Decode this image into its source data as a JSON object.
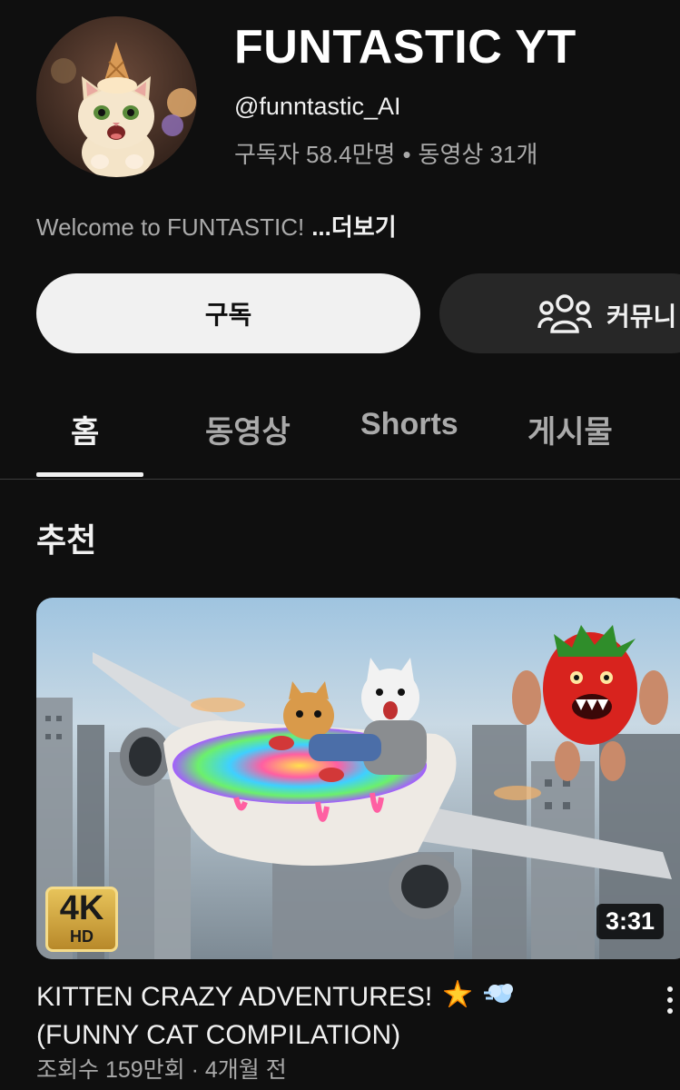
{
  "channel": {
    "title": "FUNTASTIC YT",
    "handle": "@funntastic_AI",
    "subscribers": "구독자 58.4만명",
    "separator": "•",
    "video_count": "동영상 31개",
    "description": "Welcome to FUNTASTIC!",
    "more_label": "...더보기",
    "avatar_icon": "cat-with-ice-cream-cone-icon"
  },
  "actions": {
    "subscribe_label": "구독",
    "community_label": "커뮤니",
    "community_icon": "people-group-icon"
  },
  "tabs": [
    {
      "label": "홈",
      "active": true
    },
    {
      "label": "동영상",
      "active": false
    },
    {
      "label": "Shorts",
      "active": false
    },
    {
      "label": "게시물",
      "active": false
    }
  ],
  "section": {
    "title": "추천"
  },
  "video": {
    "title_line1": "KITTEN CRAZY ADVENTURES!",
    "title_line2": "(FUNNY CAT COMPILATION)",
    "views": "조회수 159만회",
    "meta_separator": "·",
    "age": "4개월 전",
    "duration": "3:31",
    "badge_main": "4K",
    "badge_sub": "HD",
    "menu_icon": "more-vert-icon",
    "sticker_icons": [
      "sparkle-icon",
      "dash-cloud-icon"
    ]
  },
  "colors": {
    "background": "#0f0f0f",
    "primary_text": "#f1f1f1",
    "secondary_text": "#aaaaaa",
    "subscribe_bg": "#f1f1f1",
    "community_bg": "#272727"
  }
}
